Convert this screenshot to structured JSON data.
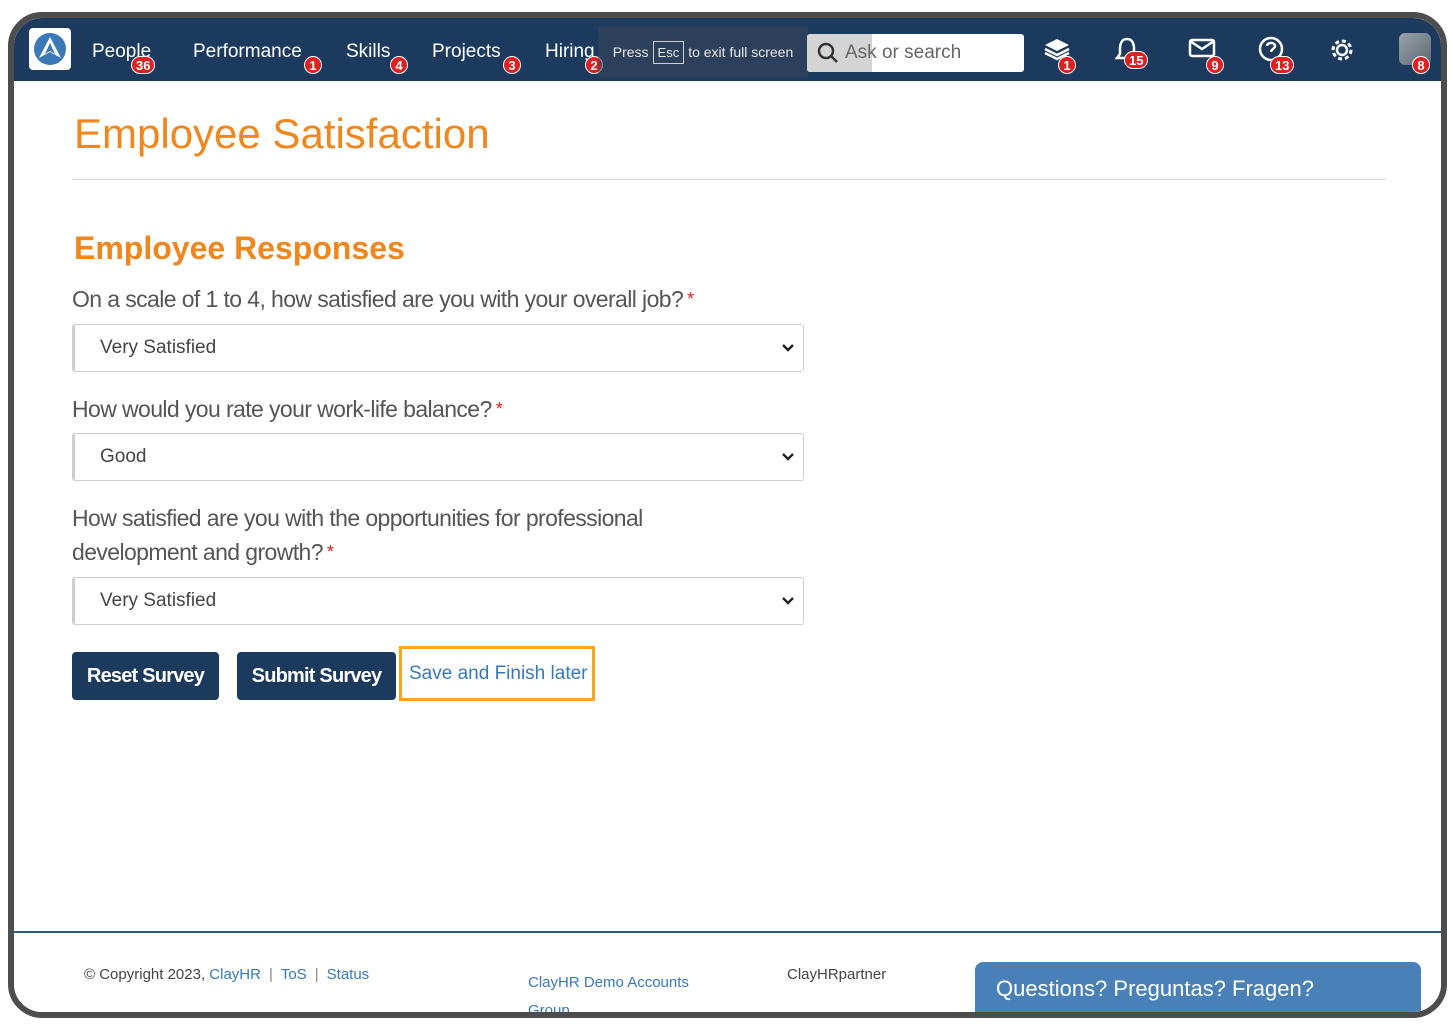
{
  "nav": {
    "items": [
      {
        "label": "People",
        "badge": "36"
      },
      {
        "label": "Performance",
        "badge": "1"
      },
      {
        "label": "Skills",
        "badge": "4"
      },
      {
        "label": "Projects",
        "badge": "3"
      },
      {
        "label": "Hiring",
        "badge": "2"
      }
    ],
    "fullscreen_hint": {
      "pre": "Press",
      "key": "Esc",
      "post": "to exit full screen"
    },
    "search_placeholder": "Ask or search",
    "icon_badges": {
      "learning": "1",
      "notifications": "15",
      "messages": "9",
      "help": "13",
      "avatar": "8"
    }
  },
  "page": {
    "title": "Employee Satisfaction",
    "section_title": "Employee Responses",
    "questions": [
      {
        "text": "On a scale of 1 to 4, how satisfied are you with your overall job?",
        "required_mark": "*",
        "selected": "Very Satisfied"
      },
      {
        "text": "How would you rate your work-life balance?",
        "required_mark": "*",
        "selected": "Good"
      },
      {
        "text_line1": "How satisfied are you with the opportunities for professional",
        "text_line2": "development and growth?",
        "required_mark": "*",
        "selected": "Very Satisfied"
      }
    ],
    "buttons": {
      "reset": "Reset Survey",
      "submit": "Submit Survey",
      "save_later": "Save and Finish later"
    }
  },
  "footer": {
    "copyright": "© Copyright 2023,",
    "brand_link": "ClayHR",
    "tos": "ToS",
    "status": "Status",
    "group_line1": "ClayHR Demo Accounts",
    "group_line2": "Group",
    "partner": "ClayHRpartner",
    "help_tab": "Questions? Preguntas? Fragen?"
  },
  "colors": {
    "nav_bg": "#1c3a5e",
    "accent_orange": "#f0861e",
    "badge_red": "#e02020",
    "link_blue": "#3a78b8",
    "focus_outline": "#f5a623",
    "help_tab": "#4a80b8"
  }
}
